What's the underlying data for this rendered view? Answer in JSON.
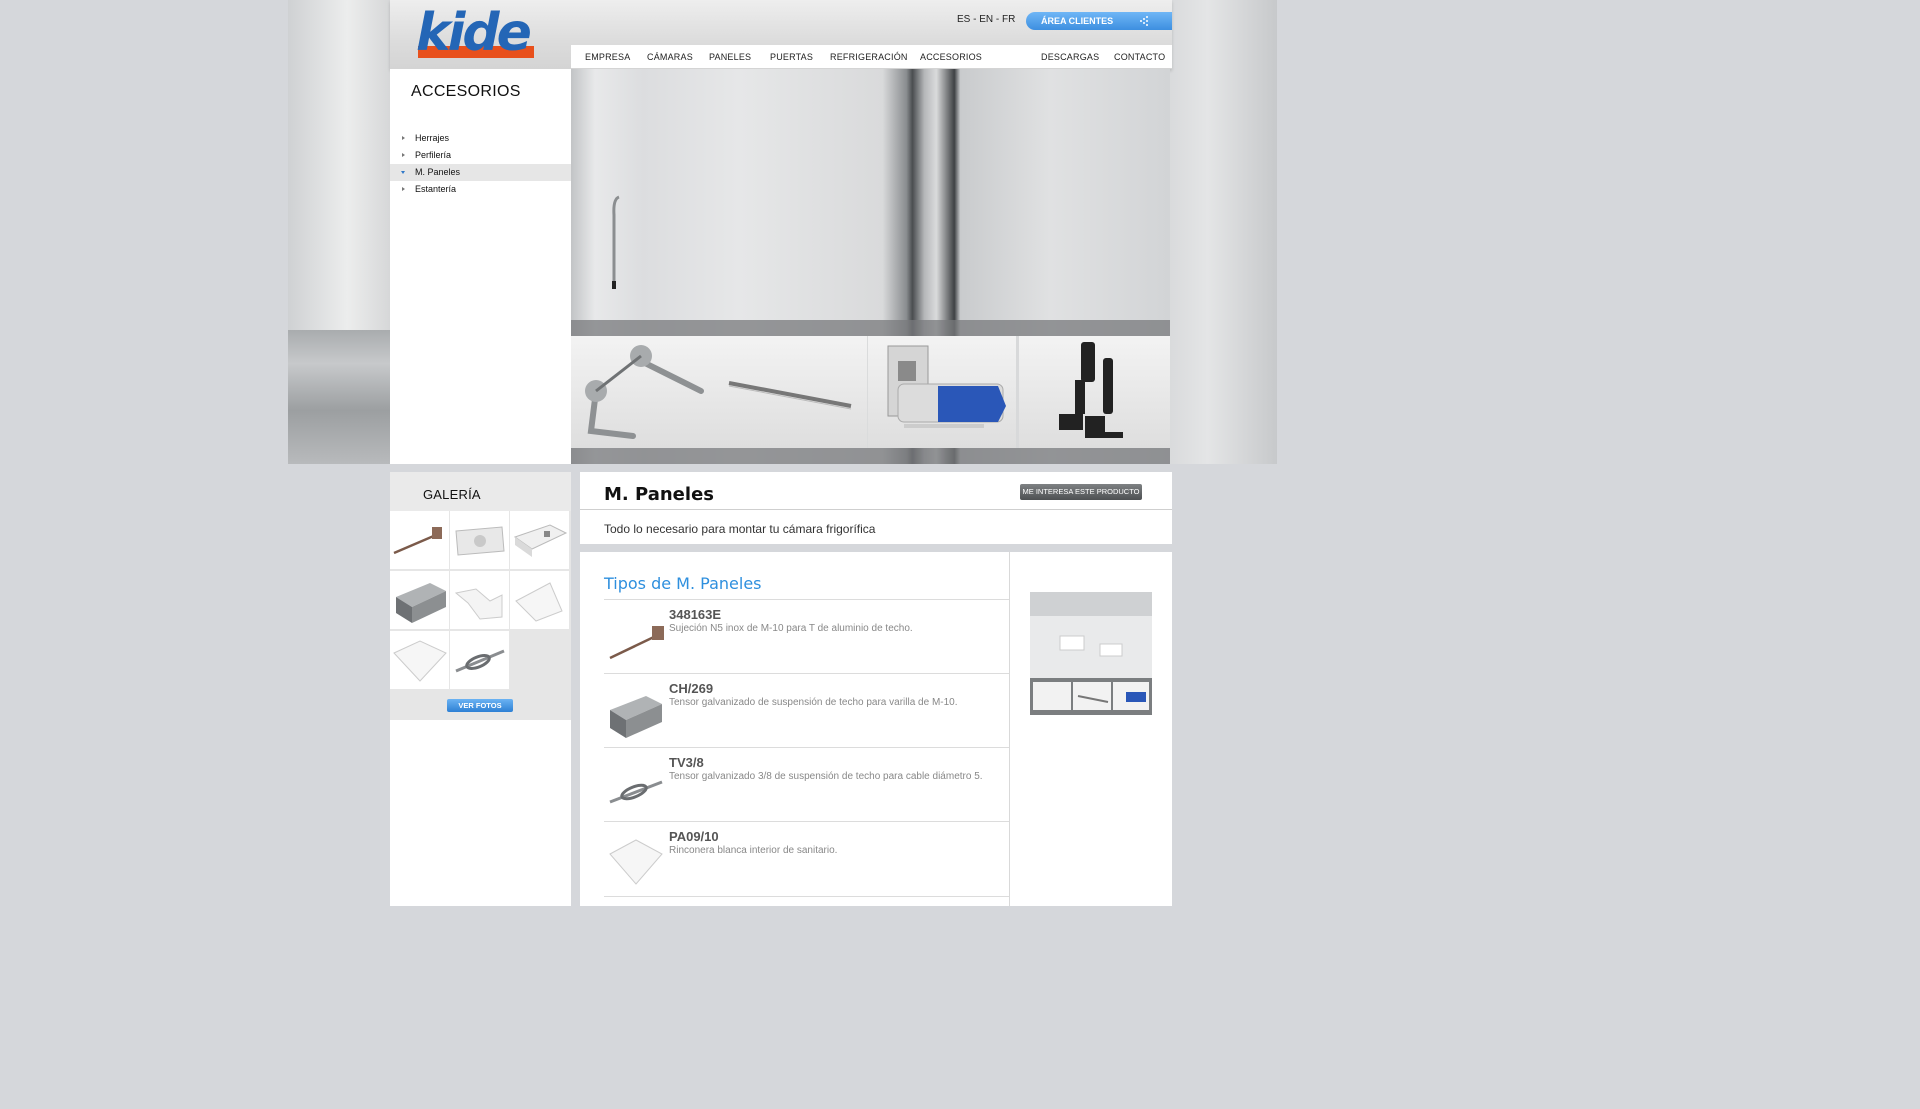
{
  "header": {
    "logo_text": "kide",
    "languages": "ES - EN - FR",
    "client_area": "ÁREA CLIENTES"
  },
  "nav": {
    "items": [
      "EMPRESA",
      "CÁMARAS",
      "PANELES",
      "PUERTAS",
      "REFRIGERACIÓN",
      "ACCESORIOS",
      "DESCARGAS",
      "CONTACTO"
    ]
  },
  "sidebar": {
    "title": "ACCESORIOS",
    "items": [
      {
        "label": "Herrajes",
        "active": false
      },
      {
        "label": "Perfilería",
        "active": false
      },
      {
        "label": "M. Paneles",
        "active": true
      },
      {
        "label": "Estantería",
        "active": false
      }
    ]
  },
  "gallery": {
    "title": "GALERÍA",
    "button": "VER FOTOS"
  },
  "product": {
    "title": "M. Paneles",
    "interest_button": "ME INTERESA ESTE PRODUCTO",
    "description": "Todo lo necesario para montar tu cámara frigorífica",
    "types_title": "Tipos de M. Paneles",
    "types": [
      {
        "code": "348163E",
        "text": "Sujeción N5 inox de M-10 para T de aluminio de techo."
      },
      {
        "code": "CH/269",
        "text": "Tensor galvanizado de suspensión de techo para varilla de M-10."
      },
      {
        "code": "TV3/8",
        "text": "Tensor galvanizado 3/8 de suspensión de techo para cable diámetro 5."
      },
      {
        "code": "PA09/10",
        "text": "Rinconera blanca interior de sanitario."
      }
    ]
  },
  "colors": {
    "accent_blue": "#2e8fde",
    "button_grey": "#5a5d60"
  }
}
